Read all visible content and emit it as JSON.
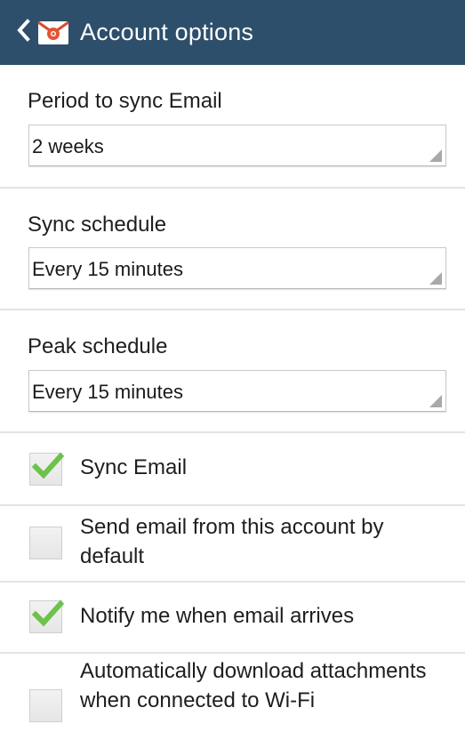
{
  "header": {
    "title": "Account options",
    "back_icon": "chevron-left-icon",
    "app_icon": "email-app-icon",
    "background_color": "#2d4f6b"
  },
  "settings": {
    "period_to_sync": {
      "label": "Period to sync Email",
      "value": "2 weeks"
    },
    "sync_schedule": {
      "label": "Sync schedule",
      "value": "Every 15 minutes"
    },
    "peak_schedule": {
      "label": "Peak schedule",
      "value": "Every 15 minutes"
    }
  },
  "checkboxes": {
    "sync_email": {
      "label": "Sync Email",
      "checked": true
    },
    "send_default": {
      "label": "Send email from this account by default",
      "checked": false
    },
    "notify": {
      "label": "Notify me when email arrives",
      "checked": true
    },
    "auto_download": {
      "label": "Automatically download attachments when connected to Wi-Fi",
      "checked": false
    }
  },
  "colors": {
    "check_green": "#6cc24a",
    "divider": "#e3e3e3"
  }
}
